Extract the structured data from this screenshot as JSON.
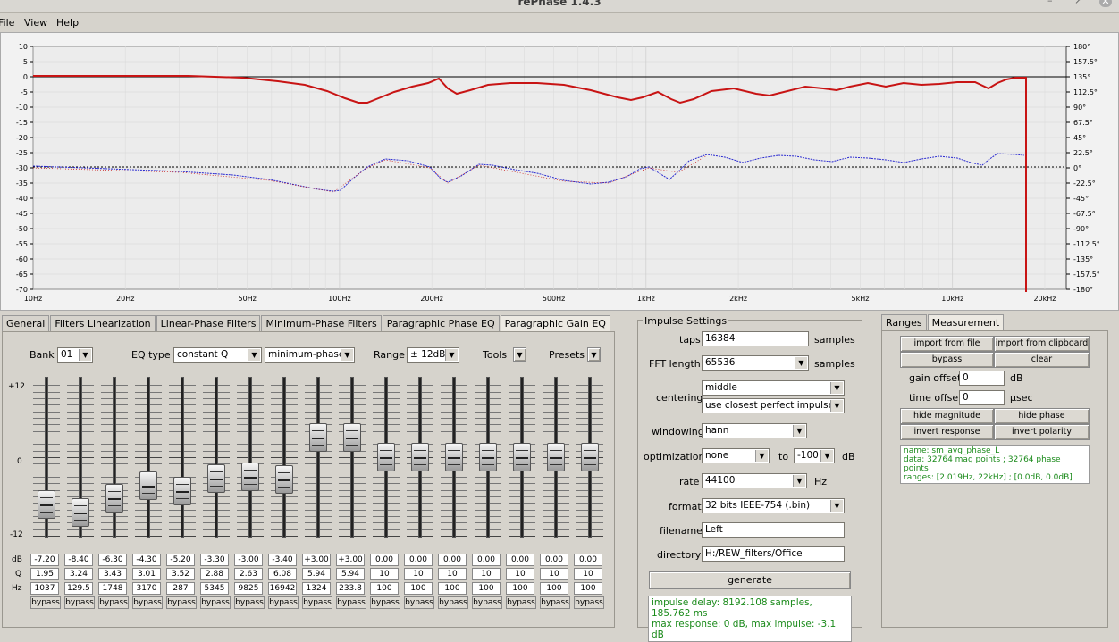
{
  "window": {
    "title": "rePhase 1.4.3"
  },
  "menu": [
    "File",
    "View",
    "Help"
  ],
  "graph": {
    "left_ticks": [
      "10",
      "5",
      "0",
      "-5",
      "-10",
      "-15",
      "-20",
      "-25",
      "-30",
      "-35",
      "-40",
      "-45",
      "-50",
      "-55",
      "-60",
      "-65",
      "-70"
    ],
    "right_ticks": [
      "180°",
      "157.5°",
      "135°",
      "112.5°",
      "90°",
      "67.5°",
      "45°",
      "22.5°",
      "0°",
      "-22.5°",
      "-45°",
      "-67.5°",
      "-90°",
      "-112.5°",
      "-135°",
      "-157.5°",
      "-180°"
    ],
    "x_ticks": [
      "10Hz",
      "20Hz",
      "50Hz",
      "100Hz",
      "200Hz",
      "500Hz",
      "1kHz",
      "2kHz",
      "5kHz",
      "10kHz",
      "20kHz"
    ]
  },
  "tabs": [
    "General",
    "Filters Linearization",
    "Linear-Phase Filters",
    "Minimum-Phase Filters",
    "Paragraphic Phase EQ",
    "Paragraphic Gain EQ"
  ],
  "eq": {
    "bank_label": "Bank",
    "bank_value": "01",
    "eqtype_label": "EQ type",
    "eqtype_value": "constant Q",
    "phase_value": "minimum-phase",
    "range_label": "Range",
    "range_value": "± 12dB",
    "tools_label": "Tools",
    "presets_label": "Presets",
    "scale_top": "+12",
    "scale_mid": "0",
    "scale_bot": "-12",
    "row_db": "dB",
    "row_q": "Q",
    "row_hz": "Hz",
    "bypass_label": "bypass",
    "bands": [
      {
        "db": "-7.20",
        "q": "1.95",
        "hz": "1037"
      },
      {
        "db": "-8.40",
        "q": "3.24",
        "hz": "129.5"
      },
      {
        "db": "-6.30",
        "q": "3.43",
        "hz": "1748"
      },
      {
        "db": "-4.30",
        "q": "3.01",
        "hz": "3170"
      },
      {
        "db": "-5.20",
        "q": "3.52",
        "hz": "287"
      },
      {
        "db": "-3.30",
        "q": "2.88",
        "hz": "5345"
      },
      {
        "db": "-3.00",
        "q": "2.63",
        "hz": "9825"
      },
      {
        "db": "-3.40",
        "q": "6.08",
        "hz": "16942"
      },
      {
        "db": "+3.00",
        "q": "5.94",
        "hz": "1324"
      },
      {
        "db": "+3.00",
        "q": "5.94",
        "hz": "233.8"
      },
      {
        "db": "0.00",
        "q": "10",
        "hz": "100"
      },
      {
        "db": "0.00",
        "q": "10",
        "hz": "100"
      },
      {
        "db": "0.00",
        "q": "10",
        "hz": "100"
      },
      {
        "db": "0.00",
        "q": "10",
        "hz": "100"
      },
      {
        "db": "0.00",
        "q": "10",
        "hz": "100"
      },
      {
        "db": "0.00",
        "q": "10",
        "hz": "100"
      },
      {
        "db": "0.00",
        "q": "10",
        "hz": "100"
      }
    ]
  },
  "impulse": {
    "title": "Impulse Settings",
    "taps_label": "taps",
    "taps_value": "16384",
    "samples": "samples",
    "fft_label": "FFT length",
    "fft_value": "65536",
    "centering_label": "centering",
    "centering_value": "middle",
    "centering_value2": "use closest perfect impulse",
    "windowing_label": "windowing",
    "windowing_value": "hann",
    "optimization_label": "optimization",
    "optimization_value": "none",
    "to_label": "to",
    "to_value": "-100",
    "db_unit": "dB",
    "rate_label": "rate",
    "rate_value": "44100",
    "hz_unit": "Hz",
    "format_label": "format",
    "format_value": "32 bits IEEE-754 (.bin)",
    "filename_label": "filename",
    "filename_value": "Left",
    "directory_label": "directory",
    "directory_value": "H:/REW_filters/Office",
    "generate_label": "generate",
    "status_line1": "impulse delay: 8192.108 samples, 185.762 ms",
    "status_line2": "max response: 0 dB, max impulse: -3.1 dB"
  },
  "measurement": {
    "tabs": [
      "Ranges",
      "Measurement"
    ],
    "import_file": "import from file",
    "import_clip": "import from clipboard",
    "bypass": "bypass",
    "clear": "clear",
    "gain_offset_label": "gain offset",
    "gain_offset_value": "0",
    "gain_unit": "dB",
    "time_offset_label": "time offset",
    "time_offset_value": "0",
    "time_unit": "µsec",
    "hide_mag": "hide magnitude",
    "hide_phase": "hide phase",
    "invert_response": "invert response",
    "invert_polarity": "invert polarity",
    "info_name": "name: sm_avg_phase_L",
    "info_data": "data: 32764 mag points ; 32764 phase points",
    "info_ranges": "ranges: [2.019Hz, 22kHz] ; [0.0dB, 0.0dB]"
  },
  "colors": {
    "magnitude": "#c81414",
    "phase_red": "#c81414",
    "phase_blue": "#2a2ad0",
    "status_green": "#1a8a1a"
  }
}
